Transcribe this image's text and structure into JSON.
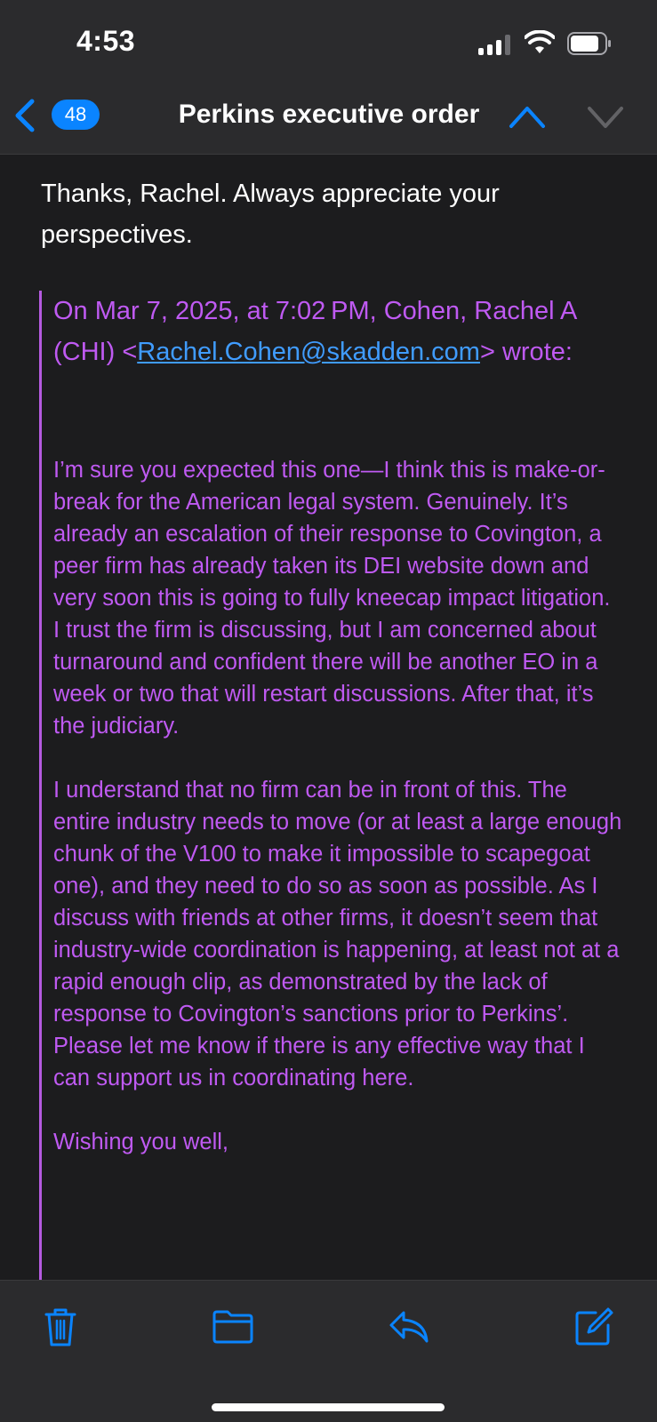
{
  "status_bar": {
    "time": "4:53",
    "icons": [
      "cellular-signal-icon",
      "wifi-icon",
      "battery-icon"
    ]
  },
  "nav": {
    "unread_count": "48",
    "title": "Perkins executive order",
    "icons": [
      "back-chevron-icon",
      "up-arrow-icon",
      "down-arrow-icon"
    ]
  },
  "colors": {
    "accent_blue": "#0a84ff",
    "quote_purple": "#bf5af2",
    "background": "#1c1c1e",
    "bar_background": "#2b2b2d"
  },
  "message": {
    "reply": "Thanks, Rachel.  Always appreciate your perspectives.",
    "quote_header_before": "On Mar 7, 2025, at 7:02 PM, Cohen, Rachel A (CHI) <",
    "quote_email": "Rachel.Cohen@skadden.com",
    "quote_header_after": "> wrote:",
    "paragraph_1": "I’m sure you expected this one—I think this is make-or-break for the American legal system. Genuinely. It’s already an escalation of their response to Covington, a peer firm has already taken its DEI website down and very soon this is going to fully kneecap impact litigation. I trust the firm is discussing, but I am concerned about turnaround and confident there will be another EO in a week or two that will restart discussions. After that, it’s the judiciary.",
    "paragraph_2": "I understand that no firm can be in front of this. The entire industry needs to move (or at least a large enough chunk of the V100 to make it impossible to scapegoat one), and they need to do so as soon as possible. As I discuss with friends at other firms, it doesn’t seem that industry-wide coordination is happening, at least not at a rapid enough clip, as demonstrated by the lack of response to Covington’s sanctions prior to Perkins’. Please let me know if there is any effective way that I can support us in coordinating here.",
    "signoff": "Wishing you well,"
  },
  "toolbar": {
    "icons": [
      "trash-icon",
      "folder-icon",
      "reply-icon",
      "compose-icon"
    ]
  }
}
